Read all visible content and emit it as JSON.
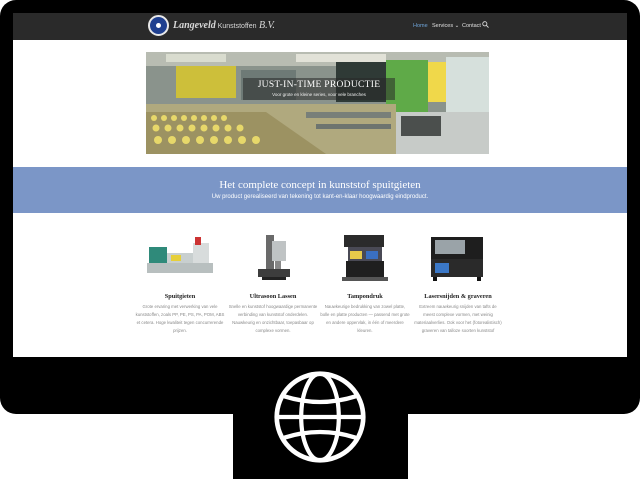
{
  "header": {
    "logo_name_styled": "Langeveld",
    "logo_name_plain": " Kunststoffen",
    "logo_suffix": " B.V.",
    "nav": [
      {
        "label": "Home",
        "active": true
      },
      {
        "label": "Services",
        "has_dropdown": true
      },
      {
        "label": "Contact"
      }
    ],
    "search_icon": "search-icon",
    "accent_color": "#6fa4d8"
  },
  "hero": {
    "title": "JUST-IN-TIME PRODUCTIE",
    "subtitle": "Voor grote en kleine series, voor vele branches"
  },
  "band": {
    "title": "Het complete concept in kunststof spuitgieten",
    "subtitle": "Uw product gerealiseerd van tekening tot kant-en-klaar hoogwaardig eindproduct.",
    "color": "#7b96c7"
  },
  "features": [
    {
      "title": "Spuitgieten",
      "description": "Grote ervaring met verwerking van vele kunststoffen, zoals PP, PE, PS, PA, POM, ABS et cetera. Hoge kwaliteit tegen concurrerende prijzen."
    },
    {
      "title": "Ultrasoon Lassen",
      "description": "Snelle en kunststof hoogwaardige permanente verbinding van kunststof onderdelen. Nauwkeurig en onzichtbaar, toepasbaar op complexe vormen."
    },
    {
      "title": "Tampondruk",
      "description": "Nauwkeurige bedrukking van zowel platte, bolle en platte producten — passend met grote en andere oppervlak, in één of meerdere kleuren."
    },
    {
      "title": "Lasersnijden & graveren",
      "description": "Extreem nauwkeurig snijden van tafts de meest complexe vormen, met weinig materiaalverlies. Ook voor het (fotorealistisch) graveren van talloze soorten kunststof"
    }
  ],
  "device_icon": "globe-icon"
}
